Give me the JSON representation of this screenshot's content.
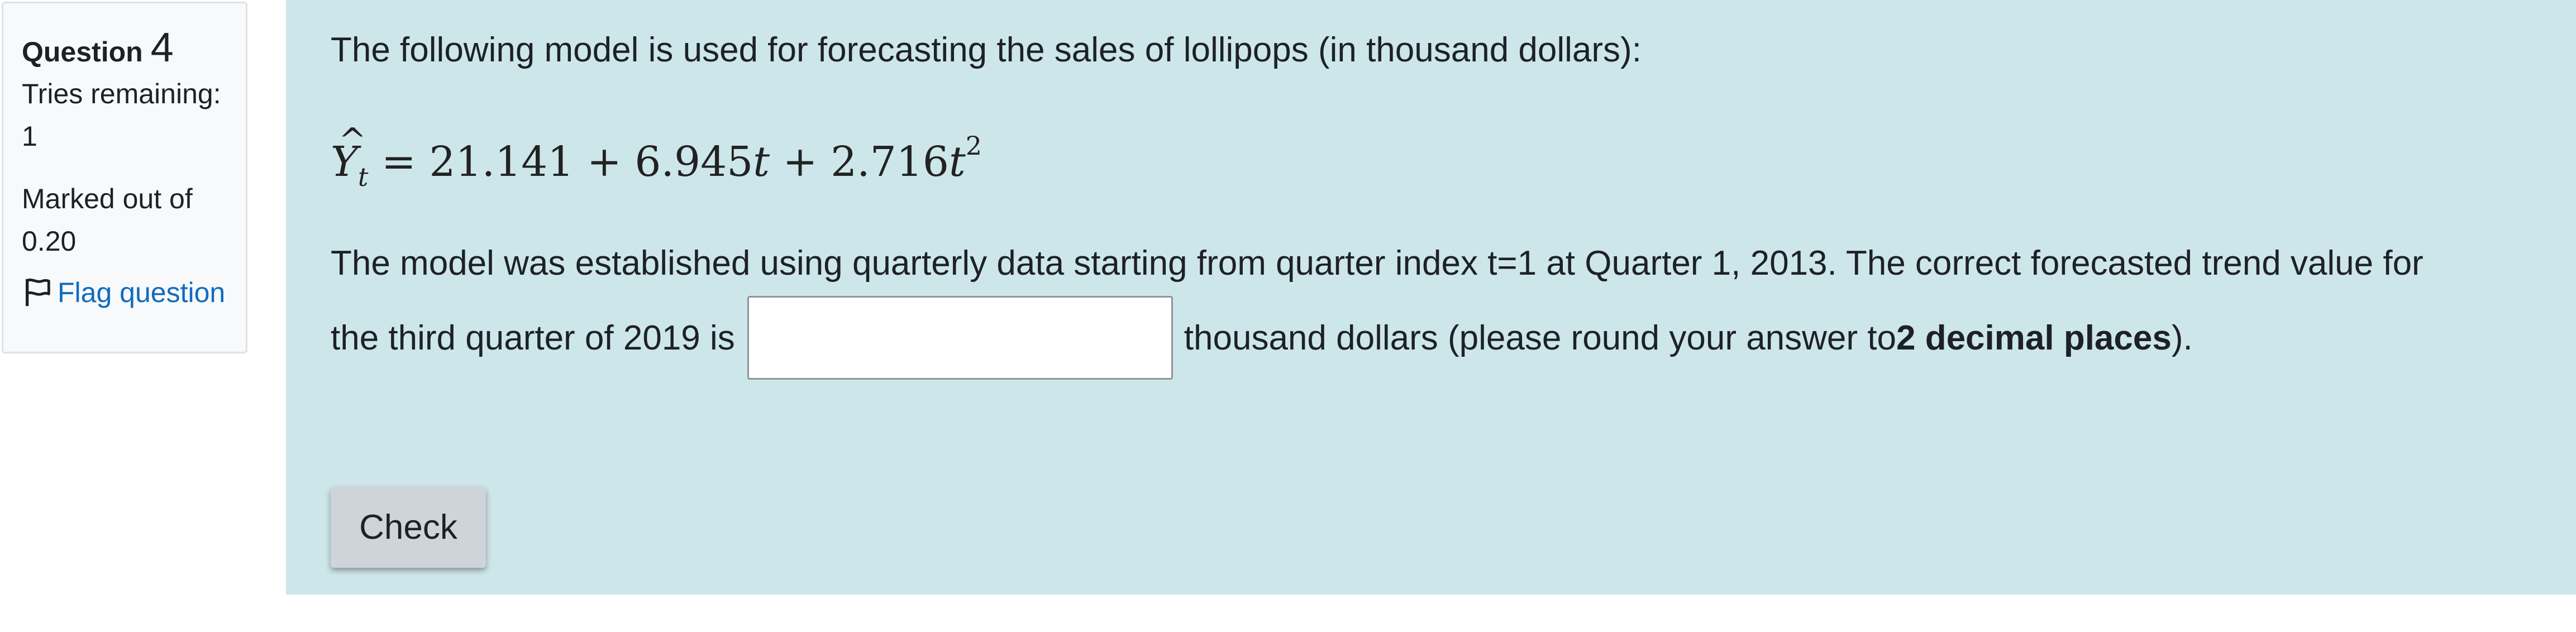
{
  "info": {
    "question_label": "Question",
    "question_number": "4",
    "tries_label": "Tries remaining:",
    "tries_value": "1",
    "marked_label": "Marked out of",
    "marked_value": "0.20",
    "flag_label": "Flag question",
    "flag_icon": "flag-outline-icon"
  },
  "question": {
    "stem": "The following model is used for forecasting the sales of lollipops (in thousand dollars):",
    "formula": {
      "lhs_var": "Y",
      "lhs_hat": "^",
      "lhs_sub": "t",
      "equals": " = ",
      "c0": "21.141",
      "plus1": " + ",
      "c1": "6.945",
      "t1": "t",
      "plus2": " + ",
      "c2": "2.716",
      "t2": "t",
      "exp": "2"
    },
    "para_line1": "The model was established using quarterly data starting from quarter index t=1 at Quarter 1, 2013. The correct forecasted trend value for",
    "para_line2_before": "the third quarter of 2019 is",
    "answer_value": "",
    "para_line2_after": "thousand dollars (please round your answer to ",
    "para_bold": "2 decimal places",
    "para_end": ")."
  },
  "actions": {
    "check_label": "Check"
  },
  "colors": {
    "formulation_bg": "#cde6ea",
    "info_bg": "#f8f9fa",
    "link": "#0f6cbf",
    "button_bg": "#ced4da"
  }
}
